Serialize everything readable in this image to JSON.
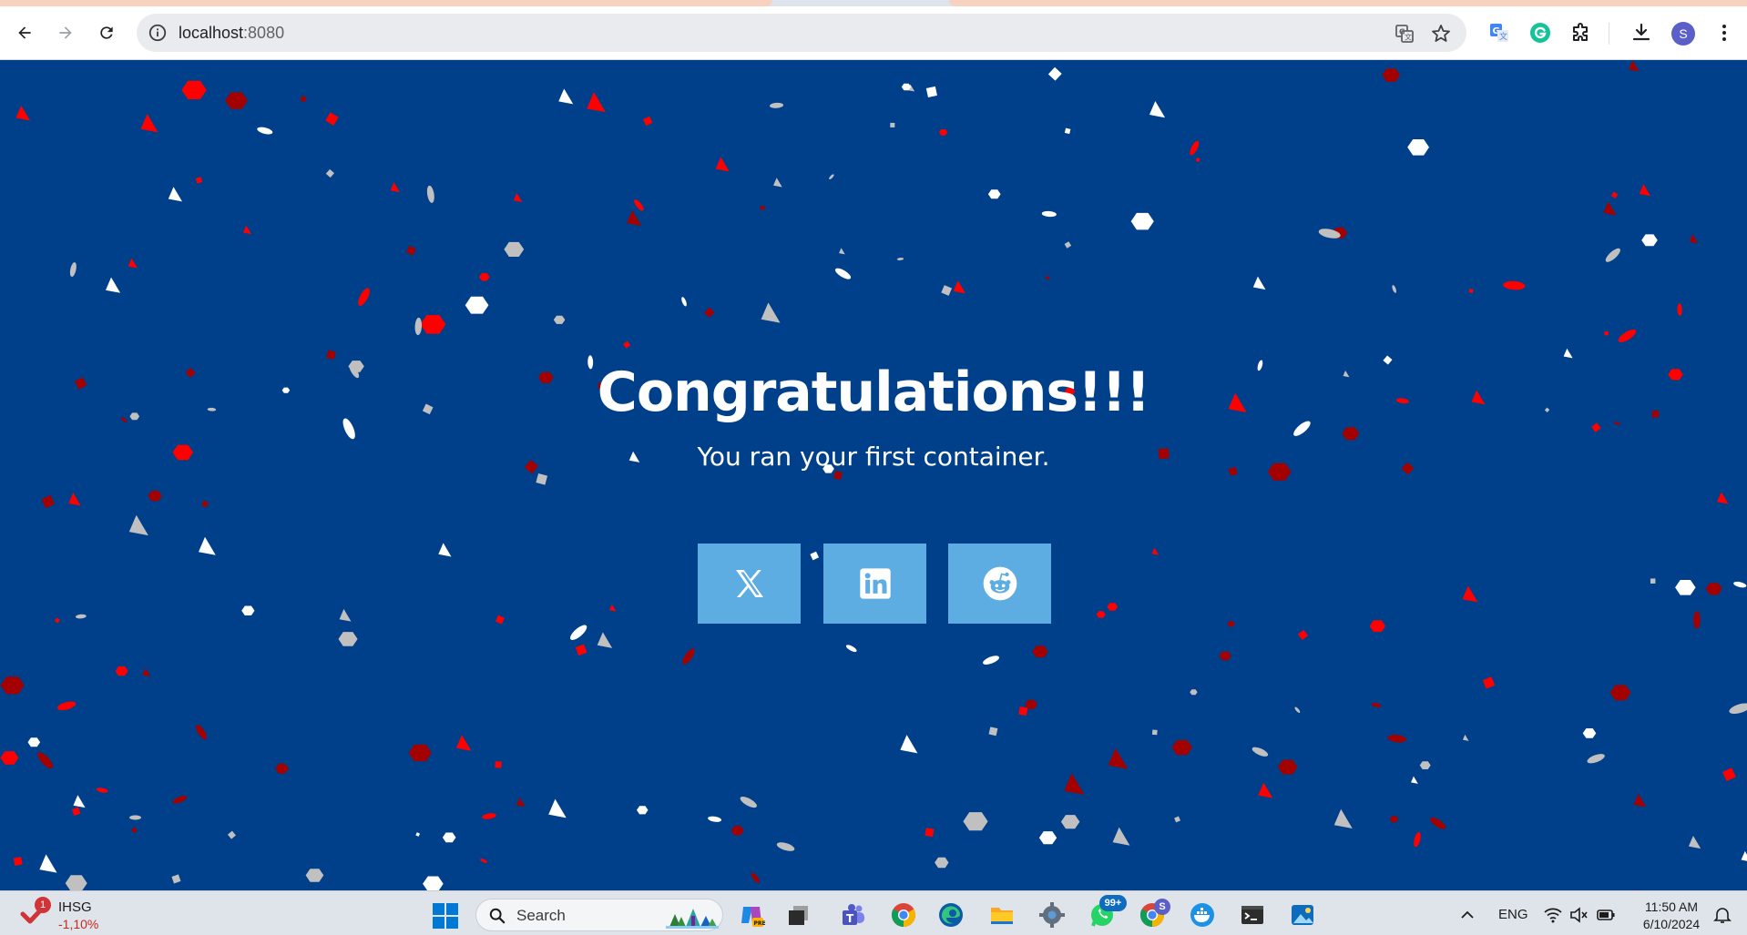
{
  "browser": {
    "url_host": "localhost",
    "url_port": ":8080",
    "profile_initial": "S"
  },
  "page": {
    "heading": "Congratulations!!!",
    "subheading": "You ran your first container.",
    "share_buttons": [
      {
        "name": "x-share-button",
        "icon": "x-logo-icon"
      },
      {
        "name": "linkedin-share-button",
        "icon": "linkedin-logo-icon"
      },
      {
        "name": "reddit-share-button",
        "icon": "reddit-logo-icon"
      }
    ],
    "colors": {
      "background": "#003f8a",
      "button": "#5dade2",
      "confetti": [
        "#ff0000",
        "#a30000",
        "#ffffff",
        "#c0c0c0"
      ]
    }
  },
  "taskbar": {
    "stock_name": "IHSG",
    "stock_change": "-1,10%",
    "stock_badge": "1",
    "search_label": "Search",
    "whatsapp_badge": "99+",
    "chrome_profile_badge": "S",
    "language": "ENG",
    "time": "11:50 AM",
    "date": "6/10/2024"
  }
}
